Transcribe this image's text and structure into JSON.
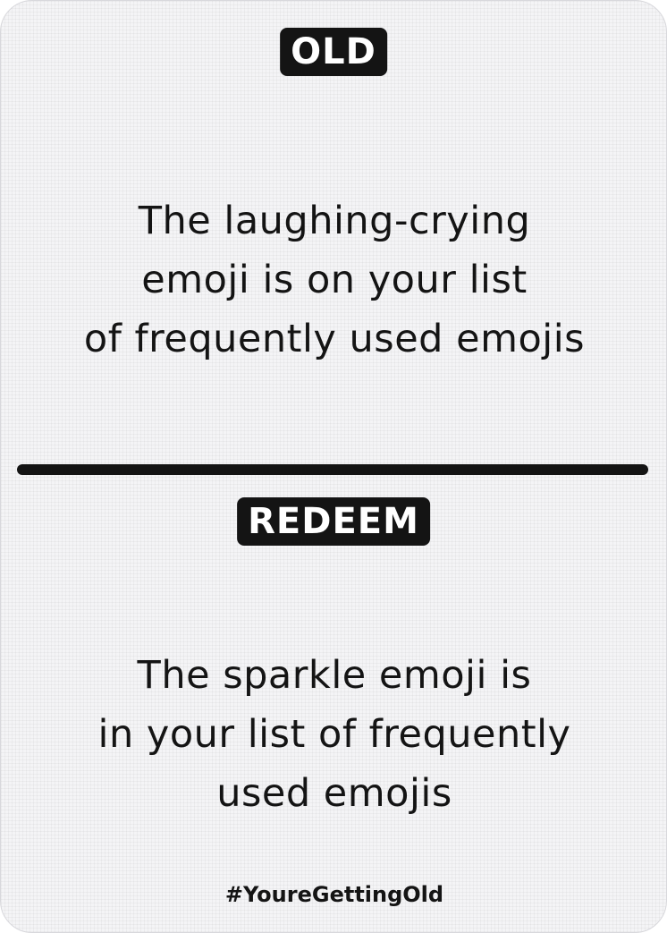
{
  "card": {
    "old_label": "OLD",
    "old_text": "The laughing-crying\nemoji is on your list\nof frequently used emojis",
    "redeem_label": "REDEEM",
    "redeem_text": "The sparkle emoji is\nin your list of frequently\nused emojis",
    "hashtag": "#YoureGettingOld"
  },
  "colors": {
    "ink": "#141414",
    "card_background": "#f4f4f6"
  }
}
